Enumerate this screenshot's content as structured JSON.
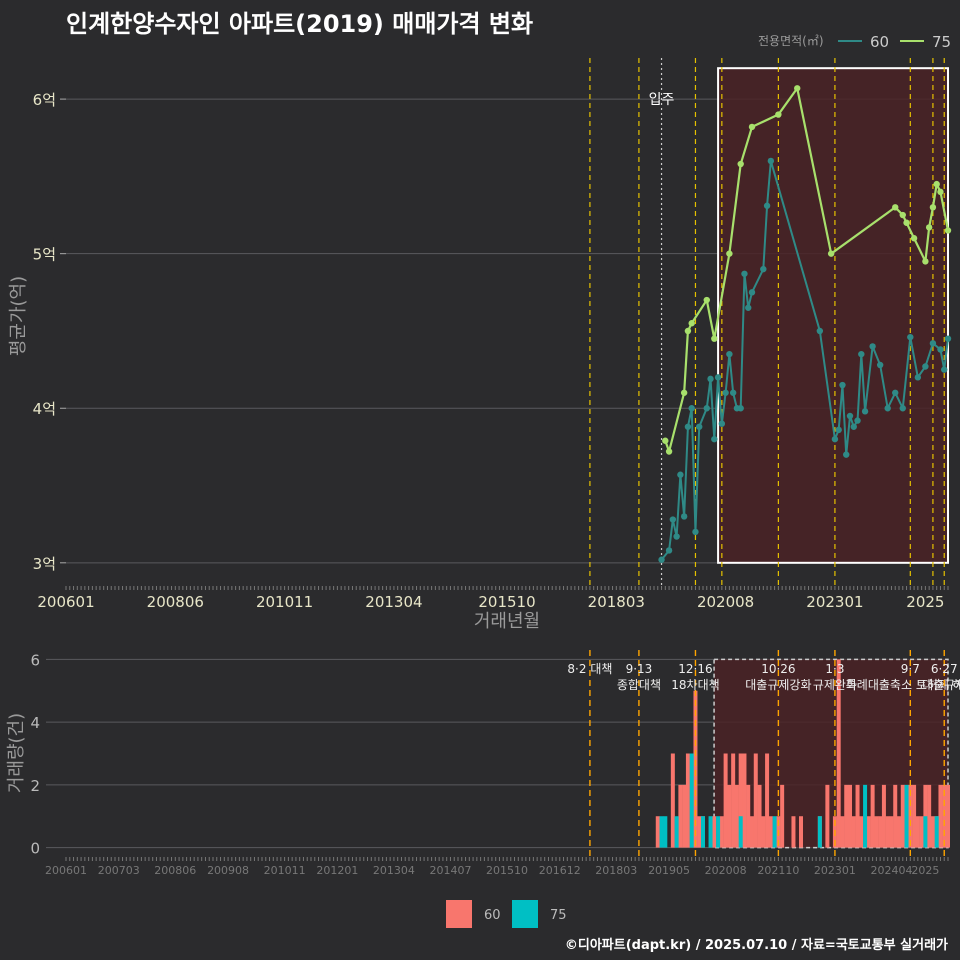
{
  "title": "인계한양수자인 아파트(2019) 매매가격 변화",
  "footer": "©디아파트(dapt.kr) / 2025.07.10 / 자료=국토교통부 실거래가",
  "colors": {
    "s60_line": "#2f8a87",
    "s75_line": "#a8e06c",
    "bar60": "#f8766d",
    "bar75": "#00bfc4",
    "policy": "#e6c200",
    "policy_bottom": "#ffa500",
    "highlight_fill": "#4a2226"
  },
  "chart_data": [
    {
      "type": "line",
      "legend": {
        "title": "전용면적(㎡)",
        "placement": "top-right",
        "entries": [
          "60",
          "75"
        ]
      },
      "xlabel": "거래년월",
      "ylabel": "평균가(억)",
      "x_range": [
        "2006-01",
        "2025-07"
      ],
      "y_range": [
        2.85,
        6.35
      ],
      "x_ticks": [
        "200601",
        "200806",
        "201011",
        "201304",
        "201510",
        "201803",
        "202008",
        "202301",
        "2025"
      ],
      "y_ticks": [
        {
          "value": 3,
          "label": "3억"
        },
        {
          "value": 4,
          "label": "4억"
        },
        {
          "value": 5,
          "label": "5억"
        },
        {
          "value": 6,
          "label": "6억"
        }
      ],
      "annotation": {
        "label": "입주",
        "x": "2019-03"
      },
      "policy_dates": [
        "2017-08",
        "2018-09",
        "2019-12",
        "2020-07",
        "2021-10",
        "2023-01",
        "2024-09",
        "2025-03",
        "2025-06"
      ],
      "highlight_range": {
        "x": [
          "2020-06",
          "2025-07"
        ],
        "y": [
          3.0,
          6.2
        ]
      },
      "series": [
        {
          "name": "60",
          "points": [
            [
              "2019-03",
              3.02
            ],
            [
              "2019-05",
              3.08
            ],
            [
              "2019-06",
              3.28
            ],
            [
              "2019-07",
              3.17
            ],
            [
              "2019-08",
              3.57
            ],
            [
              "2019-09",
              3.3
            ],
            [
              "2019-10",
              3.88
            ],
            [
              "2019-11",
              4.0
            ],
            [
              "2019-12",
              3.2
            ],
            [
              "2020-01",
              3.88
            ],
            [
              "2020-03",
              4.0
            ],
            [
              "2020-04",
              4.19
            ],
            [
              "2020-05",
              3.8
            ],
            [
              "2020-06",
              4.2
            ],
            [
              "2020-07",
              3.9
            ],
            [
              "2020-08",
              4.1
            ],
            [
              "2020-09",
              4.35
            ],
            [
              "2020-10",
              4.1
            ],
            [
              "2020-11",
              4.0
            ],
            [
              "2020-12",
              4.0
            ],
            [
              "2021-01",
              4.87
            ],
            [
              "2021-02",
              4.65
            ],
            [
              "2021-03",
              4.75
            ],
            [
              "2021-06",
              4.9
            ],
            [
              "2021-07",
              5.31
            ],
            [
              "2021-08",
              5.6
            ],
            [
              "2022-09",
              4.5
            ],
            [
              "2023-01",
              3.8
            ],
            [
              "2023-02",
              3.86
            ],
            [
              "2023-03",
              4.15
            ],
            [
              "2023-04",
              3.7
            ],
            [
              "2023-05",
              3.95
            ],
            [
              "2023-06",
              3.88
            ],
            [
              "2023-07",
              3.92
            ],
            [
              "2023-08",
              4.35
            ],
            [
              "2023-09",
              3.98
            ],
            [
              "2023-11",
              4.4
            ],
            [
              "2024-01",
              4.28
            ],
            [
              "2024-03",
              4.0
            ],
            [
              "2024-05",
              4.1
            ],
            [
              "2024-07",
              4.0
            ],
            [
              "2024-09",
              4.46
            ],
            [
              "2024-11",
              4.2
            ],
            [
              "2025-01",
              4.27
            ],
            [
              "2025-03",
              4.42
            ],
            [
              "2025-05",
              4.38
            ],
            [
              "2025-06",
              4.25
            ],
            [
              "2025-07",
              4.45
            ]
          ]
        },
        {
          "name": "75",
          "points": [
            [
              "2019-04",
              3.79
            ],
            [
              "2019-05",
              3.72
            ],
            [
              "2019-09",
              4.1
            ],
            [
              "2019-10",
              4.5
            ],
            [
              "2019-11",
              4.55
            ],
            [
              "2020-03",
              4.7
            ],
            [
              "2020-05",
              4.45
            ],
            [
              "2020-09",
              5.0
            ],
            [
              "2020-12",
              5.58
            ],
            [
              "2021-03",
              5.82
            ],
            [
              "2021-10",
              5.9
            ],
            [
              "2022-03",
              6.07
            ],
            [
              "2022-12",
              5.0
            ],
            [
              "2024-05",
              5.3
            ],
            [
              "2024-07",
              5.25
            ],
            [
              "2024-08",
              5.2
            ],
            [
              "2024-10",
              5.1
            ],
            [
              "2025-01",
              4.95
            ],
            [
              "2025-02",
              5.17
            ],
            [
              "2025-03",
              5.3
            ],
            [
              "2025-04",
              5.45
            ],
            [
              "2025-05",
              5.4
            ],
            [
              "2025-07",
              5.15
            ]
          ]
        }
      ]
    },
    {
      "type": "bar",
      "legend": {
        "placement": "bottom",
        "entries": [
          "60",
          "75"
        ]
      },
      "ylabel": "거래량(건)",
      "y_range": [
        -0.3,
        6.3
      ],
      "y_ticks": [
        0,
        2,
        4,
        6
      ],
      "x_ticks": [
        "200601",
        "200703",
        "200806",
        "200908",
        "201011",
        "201201",
        "201304",
        "201407",
        "201510",
        "201612",
        "201803",
        "201905",
        "202008",
        "202110",
        "202301",
        "202404",
        "2025"
      ],
      "policy_labels": [
        {
          "x": "2017-08",
          "lines": [
            "8·2 대책"
          ]
        },
        {
          "x": "2018-09",
          "lines": [
            "9·13",
            "종합대책"
          ]
        },
        {
          "x": "2019-12",
          "lines": [
            "12·16",
            "18차대책"
          ]
        },
        {
          "x": "2021-10",
          "lines": [
            "10·26",
            "대출규제강화"
          ]
        },
        {
          "x": "2023-01",
          "lines": [
            "1·3",
            "규제완화"
          ]
        },
        {
          "x": "2024-09",
          "lines": [
            "9·7",
            "특례대출축소 토허제 해제"
          ]
        },
        {
          "x": "2025-06",
          "lines": [
            "6·27",
            "대출규제"
          ]
        }
      ],
      "series": [
        {
          "name": "60",
          "points": [
            [
              "2019-02",
              1
            ],
            [
              "2019-06",
              3
            ],
            [
              "2019-08",
              2
            ],
            [
              "2019-09",
              2
            ],
            [
              "2019-10",
              3
            ],
            [
              "2019-12",
              5
            ],
            [
              "2020-01",
              1
            ],
            [
              "2020-02",
              1
            ],
            [
              "2020-05",
              1
            ],
            [
              "2020-07",
              1
            ],
            [
              "2020-08",
              3
            ],
            [
              "2020-09",
              2
            ],
            [
              "2020-10",
              3
            ],
            [
              "2020-11",
              2
            ],
            [
              "2020-12",
              3
            ],
            [
              "2021-01",
              3
            ],
            [
              "2021-02",
              2
            ],
            [
              "2021-03",
              1
            ],
            [
              "2021-04",
              3
            ],
            [
              "2021-05",
              2
            ],
            [
              "2021-06",
              1
            ],
            [
              "2021-07",
              3
            ],
            [
              "2021-08",
              1
            ],
            [
              "2021-10",
              1
            ],
            [
              "2021-11",
              2
            ],
            [
              "2022-02",
              1
            ],
            [
              "2022-04",
              1
            ],
            [
              "2022-09",
              1
            ],
            [
              "2022-11",
              2
            ],
            [
              "2023-01",
              1
            ],
            [
              "2023-02",
              6
            ],
            [
              "2023-03",
              1
            ],
            [
              "2023-04",
              2
            ],
            [
              "2023-05",
              2
            ],
            [
              "2023-06",
              1
            ],
            [
              "2023-07",
              2
            ],
            [
              "2023-08",
              1
            ],
            [
              "2023-10",
              1
            ],
            [
              "2023-11",
              2
            ],
            [
              "2023-12",
              1
            ],
            [
              "2024-01",
              1
            ],
            [
              "2024-02",
              2
            ],
            [
              "2024-03",
              1
            ],
            [
              "2024-04",
              1
            ],
            [
              "2024-05",
              2
            ],
            [
              "2024-06",
              1
            ],
            [
              "2024-07",
              2
            ],
            [
              "2024-08",
              1
            ],
            [
              "2024-09",
              2
            ],
            [
              "2024-10",
              2
            ],
            [
              "2024-11",
              1
            ],
            [
              "2024-12",
              1
            ],
            [
              "2025-01",
              2
            ],
            [
              "2025-02",
              2
            ],
            [
              "2025-03",
              1
            ],
            [
              "2025-04",
              1
            ],
            [
              "2025-05",
              2
            ],
            [
              "2025-06",
              2
            ],
            [
              "2025-07",
              2
            ]
          ]
        },
        {
          "name": "75",
          "points": [
            [
              "2019-03",
              1
            ],
            [
              "2019-04",
              1
            ],
            [
              "2019-07",
              1
            ],
            [
              "2019-11",
              3
            ],
            [
              "2020-02",
              1
            ],
            [
              "2020-04",
              1
            ],
            [
              "2020-06",
              1
            ],
            [
              "2020-12",
              1
            ],
            [
              "2021-09",
              1
            ],
            [
              "2022-09",
              1
            ],
            [
              "2023-09",
              2
            ],
            [
              "2024-08",
              2
            ],
            [
              "2025-01",
              1
            ],
            [
              "2025-04",
              1
            ]
          ]
        }
      ]
    }
  ]
}
